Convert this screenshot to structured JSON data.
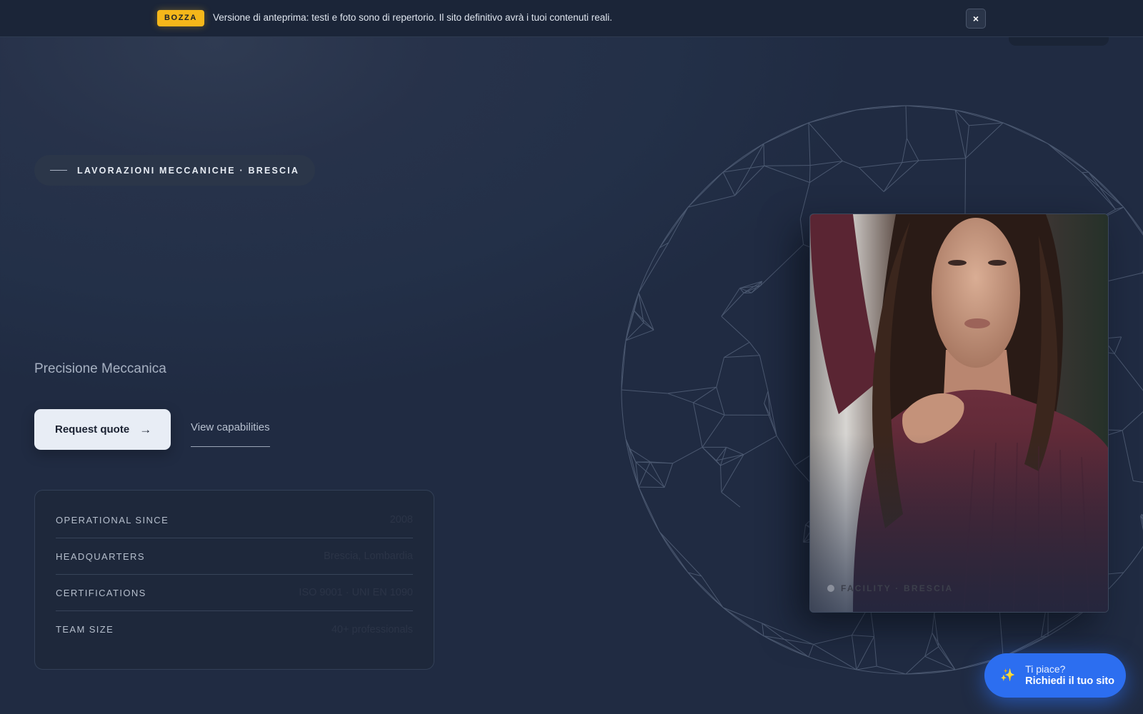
{
  "banner": {
    "badge": "BOZZA",
    "text": "Versione di anteprima: testi e foto sono di repertorio. Il sito definitivo avrà i tuoi contenuti reali.",
    "close_label": "×"
  },
  "hero": {
    "eyebrow": "LAVORAZIONI MECCANICHE · BRESCIA",
    "subtitle": "Precisione Meccanica",
    "primary_cta": "Request quote",
    "primary_cta_icon": "→",
    "secondary_cta": "View capabilities"
  },
  "facts": [
    {
      "label": "OPERATIONAL SINCE",
      "value": "2008"
    },
    {
      "label": "HEADQUARTERS",
      "value": "Brescia, Lombardia"
    },
    {
      "label": "CERTIFICATIONS",
      "value": "ISO 9001 · UNI EN 1090"
    },
    {
      "label": "TEAM SIZE",
      "value": "40+ professionals"
    }
  ],
  "photo": {
    "caption": "FACILITY · BRESCIA"
  },
  "floating_cta": {
    "icon": "✨",
    "line1": "Ti piace?",
    "line2": "Richiedi il tuo sito"
  },
  "colors": {
    "background": "#212c43",
    "badge": "#f5b71a",
    "cta_blue": "#2c6ef0",
    "button_light": "#e8edf5"
  }
}
